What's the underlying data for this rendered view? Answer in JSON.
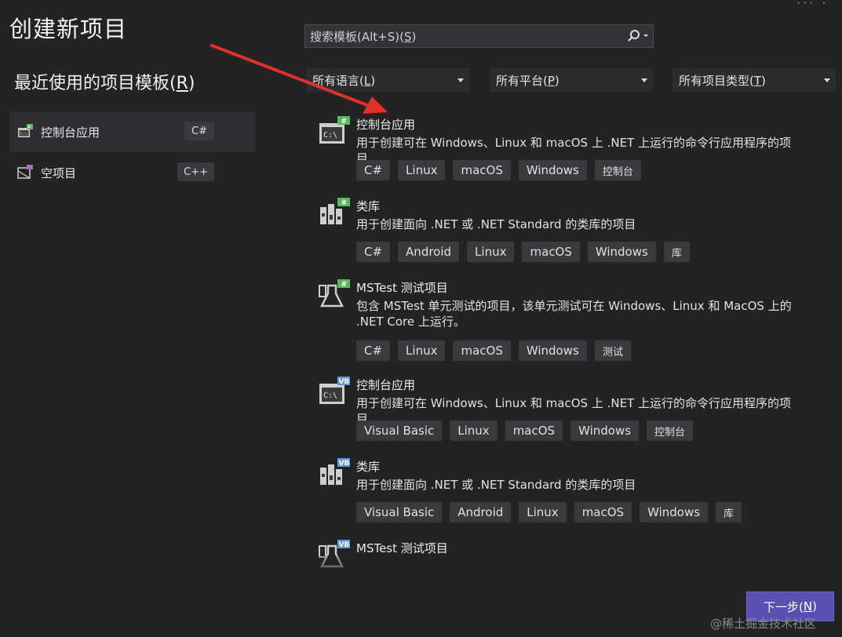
{
  "page": {
    "title": "创建新项目"
  },
  "recent": {
    "title": "最近使用的项目模板(R)",
    "title_main": "最近使用的项目模板(",
    "title_key": "R",
    "title_end": ")",
    "items": [
      {
        "label": "控制台应用",
        "lang": "C#",
        "icon": "console-app-icon"
      },
      {
        "label": "空项目",
        "lang": "C++",
        "icon": "empty-project-icon"
      }
    ]
  },
  "search": {
    "placeholder": "搜索模板(Alt+S)(S)",
    "prefix": "搜索模板(Alt+S)(",
    "key": "S",
    "suffix": ")"
  },
  "filters": [
    {
      "label": "所有语言(L)",
      "main": "所有语言(",
      "key": "L",
      "end": ")"
    },
    {
      "label": "所有平台(P)",
      "main": "所有平台(",
      "key": "P",
      "end": ")"
    },
    {
      "label": "所有项目类型(T)",
      "main": "所有项目类型(",
      "key": "T",
      "end": ")"
    }
  ],
  "templates": [
    {
      "name": "控制台应用",
      "badge": "C#",
      "icon": "console-app-icon",
      "desc": "用于创建可在 Windows、Linux 和 macOS 上 .NET 上运行的命令行应用程序的项目",
      "tags": [
        "C#",
        "Linux",
        "macOS",
        "Windows",
        "控制台"
      ]
    },
    {
      "name": "类库",
      "badge": "C#",
      "icon": "class-library-icon",
      "desc": "用于创建面向 .NET 或 .NET Standard 的类库的项目",
      "tags": [
        "C#",
        "Android",
        "Linux",
        "macOS",
        "Windows",
        "库"
      ]
    },
    {
      "name": "MSTest 测试项目",
      "badge": "C#",
      "icon": "test-flask-icon",
      "desc": "包含 MSTest 单元测试的项目，该单元测试可在 Windows、Linux 和 MacOS 上的 .NET Core 上运行。",
      "tags": [
        "C#",
        "Linux",
        "macOS",
        "Windows",
        "测试"
      ]
    },
    {
      "name": "控制台应用",
      "badge": "VB",
      "icon": "console-app-icon",
      "desc": "用于创建可在 Windows、Linux 和 macOS 上 .NET 上运行的命令行应用程序的项目",
      "tags": [
        "Visual Basic",
        "Linux",
        "macOS",
        "Windows",
        "控制台"
      ]
    },
    {
      "name": "类库",
      "badge": "VB",
      "icon": "class-library-icon",
      "desc": "用于创建面向 .NET 或 .NET Standard 的类库的项目",
      "tags": [
        "Visual Basic",
        "Android",
        "Linux",
        "macOS",
        "Windows",
        "库"
      ]
    },
    {
      "name": "MSTest 测试项目",
      "badge": "VB",
      "icon": "test-flask-icon",
      "desc": "",
      "tags": []
    }
  ],
  "next_button": {
    "label": "下一步(N)",
    "main": "下一步(",
    "key": "N",
    "end": ")"
  },
  "watermark": "@稀土掘金技术社区",
  "colors": {
    "background": "#232324",
    "csharp_badge": "#5cb85c",
    "vb_badge": "#5b9bd5",
    "primary_button": "#5a4fb3",
    "arrow": "#e0302a"
  }
}
